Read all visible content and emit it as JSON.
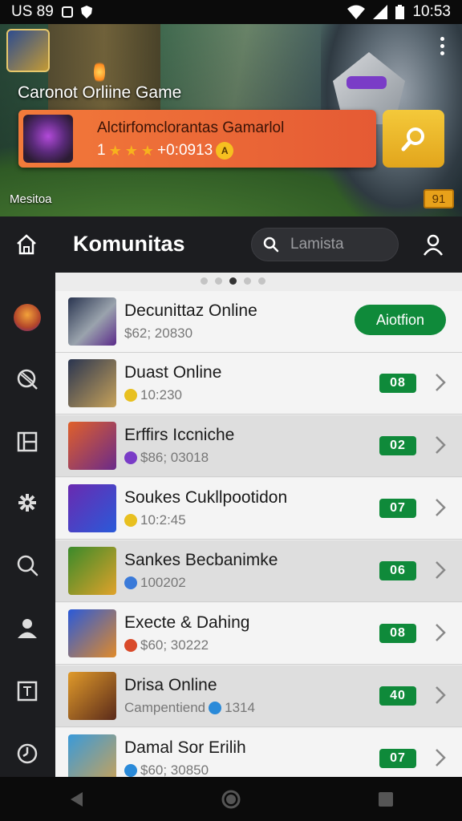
{
  "status_bar": {
    "carrier": "US 89",
    "time": "10:53"
  },
  "hero": {
    "title": "Caronot Orliine Game",
    "caption": "Mesitoa",
    "badge": "91",
    "promo": {
      "title": "Alctirfomclorantas Gamarlol",
      "rating_prefix": "1",
      "stars": 3,
      "value": "+0:0913",
      "coin_glyph": "A"
    }
  },
  "topbar": {
    "title": "Komunitas",
    "search_placeholder": "Lamista"
  },
  "carousel": {
    "count": 5,
    "active_index": 2
  },
  "featured": {
    "title": "Decunittaz Online",
    "subtitle": "$62; 20830",
    "action_label": "Aiotfion"
  },
  "list": [
    {
      "title": "Duast Online",
      "subtitle": "10:230",
      "badge": "08",
      "thumb_colors": [
        "#2a3550",
        "#c7a25a"
      ],
      "icon_color": "#e8c020"
    },
    {
      "title": "Erffirs Iccniche",
      "subtitle": "$86; 03018",
      "badge": "02",
      "thumb_colors": [
        "#e0602a",
        "#6a2a8a"
      ],
      "icon_color": "#7a3cc7"
    },
    {
      "title": "Soukes Cukllpootidon",
      "subtitle": "10:2:45",
      "badge": "07",
      "thumb_colors": [
        "#6a2ab0",
        "#2a5ad9"
      ],
      "icon_color": "#e8c020"
    },
    {
      "title": "Sankes Becbanimke",
      "subtitle": "100202",
      "badge": "06",
      "thumb_colors": [
        "#3a8a2a",
        "#e0a22a"
      ],
      "icon_color": "#3a7ad9"
    },
    {
      "title": "Execte & Dahing",
      "subtitle": "$60; 30222",
      "badge": "08",
      "thumb_colors": [
        "#2a5ad9",
        "#e08a2a"
      ],
      "icon_color": "#d94a2a"
    },
    {
      "title": "Drisa Online",
      "subtitle": "Campentiend",
      "subtitle_extra": "1314",
      "badge": "40",
      "thumb_colors": [
        "#e09a2a",
        "#5a2a1a"
      ],
      "icon_color": "#2a8ad9"
    },
    {
      "title": "Damal Sor Erilih",
      "subtitle": "$60; 30850",
      "badge": "07",
      "thumb_colors": [
        "#3a9ad9",
        "#c7a25a"
      ],
      "icon_color": "#2a8ad9"
    }
  ],
  "colors": {
    "accent_green": "#0f8a3a",
    "promo_orange": "#f27a3a",
    "search_yellow": "#f4c93a",
    "dark_bar": "#1c1d20"
  }
}
